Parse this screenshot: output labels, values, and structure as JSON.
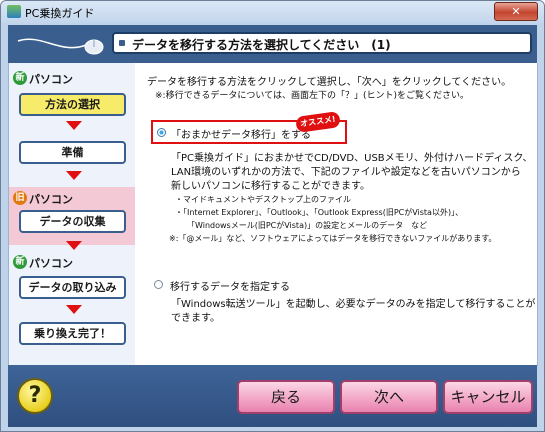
{
  "window": {
    "title": "PC乗換ガイド",
    "close_label": "✕"
  },
  "header": {
    "title": "データを移行する方法を選択してください　(1)"
  },
  "sidebar": {
    "new_pc_label": "パソコン",
    "new_badge": "新",
    "old_pc_label": "パソコン",
    "old_badge": "旧",
    "new_pc2_label": "パソコン",
    "steps": {
      "select_method": "方法の選択",
      "prepare": "準備",
      "collect": "データの収集",
      "import": "データの取り込み",
      "complete": "乗り換え完了！"
    }
  },
  "content": {
    "intro_line1": "データを移行する方法をクリックして選択し、「次へ」をクリックしてください。",
    "intro_line2": "※:移行できるデータについては、画面左下の「？」(ヒント)をご覧ください。",
    "option1": {
      "label": "「おまかせデータ移行」をする",
      "badge": "オススメ!",
      "desc_line1": "「PC乗換ガイド」におまかせでCD/DVD、USBメモリ、外付けハードディスク、",
      "desc_line2": "LAN環境のいずれかの方法で、下記のファイルや設定などを古いパソコンから",
      "desc_line3": "新しいパソコンに移行することができます。",
      "bullet1": "・マイドキュメントやデスクトップ上のファイル",
      "bullet2": "・「Internet Explorer」、「Outlook」、「Outlook Express(旧PCがVista以外)」、",
      "bullet3": "「Windowsメール(旧PCがVista)」の設定とメールのデータ　など",
      "note": "※:「@メール」など、ソフトウェアによってはデータを移行できないファイルがあります。",
      "selected": true
    },
    "option2": {
      "label": "移行するデータを指定する",
      "desc_line1": "「Windows転送ツール」を起動し、必要なデータのみを指定して移行することが",
      "desc_line2": "できます。",
      "selected": false
    }
  },
  "footer": {
    "help_label": "?",
    "back_label": "戻る",
    "next_label": "次へ",
    "cancel_label": "キャンセル"
  },
  "colors": {
    "accent_red": "#e01010",
    "header_blue": "#3a5f8f",
    "active_step": "#f6ec6a",
    "button_pink": "#f2a3c4"
  }
}
